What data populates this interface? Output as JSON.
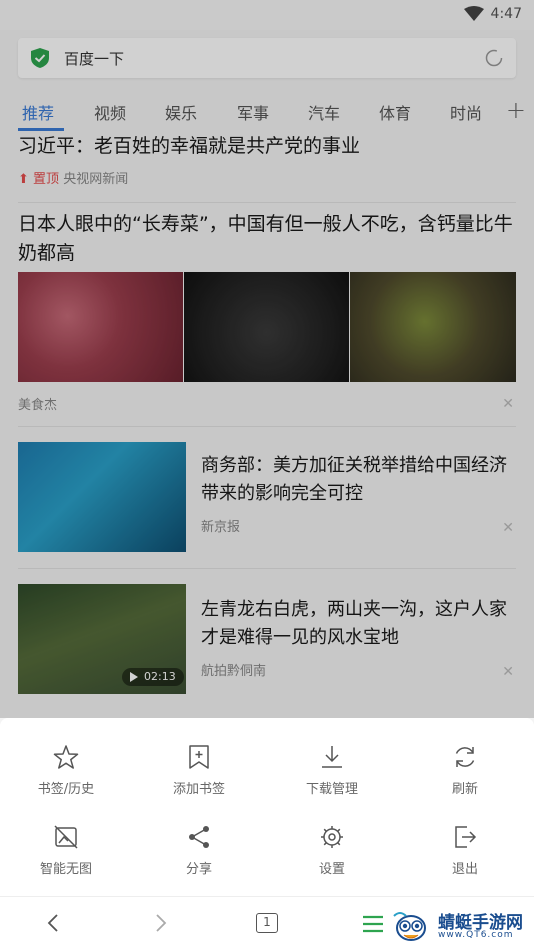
{
  "status": {
    "time": "4:47"
  },
  "search": {
    "text": "百度一下"
  },
  "tabs": [
    "推荐",
    "视频",
    "娱乐",
    "军事",
    "汽车",
    "体育",
    "时尚"
  ],
  "feed": {
    "top": {
      "title": "习近平：老百姓的幸福就是共产党的事业",
      "pin": "置顶",
      "source": "央视网新闻"
    },
    "item1": {
      "title": "日本人眼中的“长寿菜”，中国有但一般人不吃，含钙量比牛奶都高",
      "source": "美食杰"
    },
    "item2": {
      "title": "商务部：美方加征关税举措给中国经济带来的影响完全可控",
      "source": "新京报"
    },
    "item3": {
      "title": "左青龙右白虎，两山夹一沟，这户人家才是难得一见的风水宝地",
      "source": "航拍黔侗南",
      "duration": "02:13"
    }
  },
  "menu": {
    "row1": [
      "书签/历史",
      "添加书签",
      "下载管理",
      "刷新"
    ],
    "row2": [
      "智能无图",
      "分享",
      "设置",
      "退出"
    ]
  },
  "nav": {
    "tab_count": "1"
  },
  "watermark": {
    "title": "蜻蜓手游网",
    "url": "www.QT6.com"
  },
  "colors": {
    "accent": "#3a7bd5",
    "pin": "#e54c4c",
    "shield": "#2ea44f"
  }
}
